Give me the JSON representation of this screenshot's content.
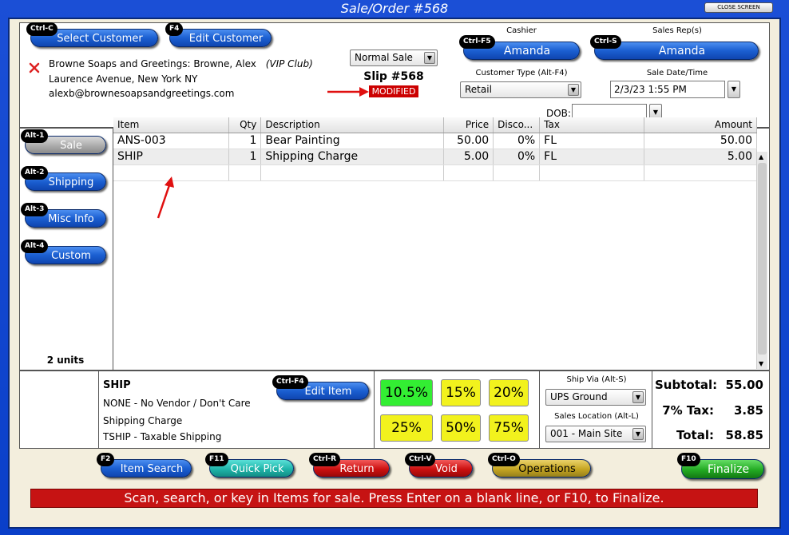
{
  "window": {
    "title": "Sale/Order #568",
    "close_label": "CLOSE SCREEN"
  },
  "customer": {
    "select_label": "Select Customer",
    "select_key": "Ctrl-C",
    "edit_label": "Edit Customer",
    "edit_key": "F4",
    "name": "Browne Soaps and Greetings: Browne, Alex",
    "club": "(VIP Club)",
    "address": "Laurence Avenue, New York NY",
    "email": "alexb@brownesoapsandgreetings.com"
  },
  "sale": {
    "type": "Normal Sale",
    "slip": "Slip #568",
    "modified": "MODIFIED"
  },
  "cashier": {
    "label": "Cashier",
    "key": "Ctrl-F5",
    "name": "Amanda"
  },
  "sales_rep": {
    "label": "Sales Rep(s)",
    "key": "Ctrl-S",
    "name": "Amanda"
  },
  "customer_type": {
    "label": "Customer Type (Alt-F4)",
    "value": "Retail"
  },
  "sale_date": {
    "label": "Sale Date/Time",
    "value": "2/3/23 1:55 PM"
  },
  "dob": {
    "label": "DOB:",
    "value": ""
  },
  "side_tabs": [
    {
      "key": "Alt-1",
      "label": "Sale"
    },
    {
      "key": "Alt-2",
      "label": "Shipping"
    },
    {
      "key": "Alt-3",
      "label": "Misc Info"
    },
    {
      "key": "Alt-4",
      "label": "Custom"
    }
  ],
  "units": "2 units",
  "grid": {
    "headers": [
      "Item",
      "Qty",
      "Description",
      "Price",
      "Disco...",
      "Tax",
      "Amount"
    ],
    "rows": [
      {
        "item": "ANS-003",
        "qty": "1",
        "description": "Bear Painting",
        "price": "50.00",
        "discount": "0%",
        "tax": "FL",
        "amount": "50.00"
      },
      {
        "item": "SHIP",
        "qty": "1",
        "description": "Shipping Charge",
        "price": "5.00",
        "discount": "0%",
        "tax": "FL",
        "amount": "5.00"
      }
    ]
  },
  "detail": {
    "item": "SHIP",
    "vendor": "NONE - No Vendor / Don't Care",
    "description": "Shipping Charge",
    "tax": "TSHIP - Taxable Shipping",
    "edit_label": "Edit Item",
    "edit_key": "Ctrl-F4"
  },
  "discounts": [
    "10.5%",
    "15%",
    "20%",
    "25%",
    "50%",
    "75%"
  ],
  "ship_via": {
    "label": "Ship Via (Alt-S)",
    "value": "UPS Ground"
  },
  "sales_location": {
    "label": "Sales Location (Alt-L)",
    "value": "001 - Main Site"
  },
  "totals": {
    "subtotal_label": "Subtotal:",
    "subtotal": "55.00",
    "tax_label": "7% Tax:",
    "tax": "3.85",
    "total_label": "Total:",
    "total": "58.85"
  },
  "bottom_buttons": [
    {
      "key": "F2",
      "label": "Item Search"
    },
    {
      "key": "F11",
      "label": "Quick Pick"
    },
    {
      "key": "Ctrl-R",
      "label": "Return"
    },
    {
      "key": "Ctrl-V",
      "label": "Void"
    },
    {
      "key": "Ctrl-O",
      "label": "Operations"
    },
    {
      "key": "F10",
      "label": "Finalize"
    }
  ],
  "status": "Scan, search, or key in Items for sale. Press Enter on a blank line, or F10, to Finalize.",
  "colors": {
    "accent_blue": "#1b5fd1",
    "modified_red": "#cc0000",
    "status_red": "#c61313",
    "frame_bg": "#f3eedd"
  }
}
